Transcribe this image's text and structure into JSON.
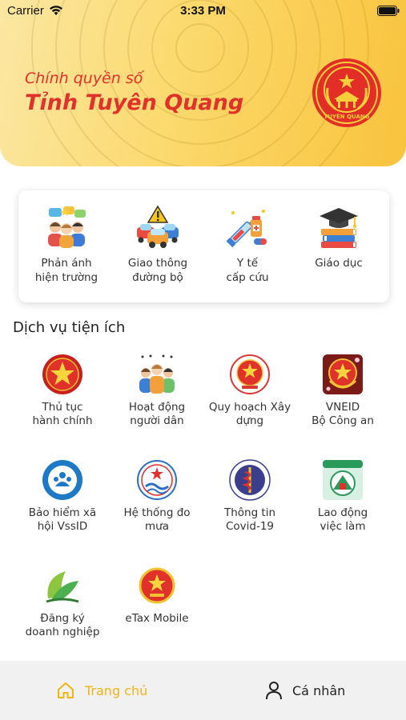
{
  "status_bar": {
    "carrier": "Carrier",
    "time": "3:33 PM"
  },
  "header": {
    "subtitle": "Chính quyền số",
    "title": "Tỉnh Tuyên Quang",
    "emblem_text": "TUYÊN QUANG",
    "colors": {
      "title": "#e0312b",
      "gradient_start": "#fbe7a3",
      "gradient_end": "#f9c33c"
    }
  },
  "quick_actions": [
    {
      "label": "Phản ánh\nhiện trường",
      "icon": "people-feedback-icon"
    },
    {
      "label": "Giao thông\nđường bộ",
      "icon": "traffic-cars-icon"
    },
    {
      "label": "Y tế\ncấp cứu",
      "icon": "medical-syringe-icon"
    },
    {
      "label": "Giáo dục",
      "icon": "graduation-books-icon"
    }
  ],
  "services": {
    "title": "Dịch vụ tiện ích",
    "items": [
      {
        "label": "Thủ tục\nhành chính",
        "icon": "red-star-icon"
      },
      {
        "label": "Hoạt động\nngười dân",
        "icon": "people-group-icon"
      },
      {
        "label": "Quy hoạch Xây\ndựng",
        "icon": "emblem-planning-icon"
      },
      {
        "label": "VNEID\nBộ Công an",
        "icon": "police-badge-icon"
      },
      {
        "label": "Bảo hiểm xã\nhội VssID",
        "icon": "social-insurance-icon"
      },
      {
        "label": "Hệ thống đo\nmưa",
        "icon": "rain-measure-icon"
      },
      {
        "label": "Thông tin\nCovid-19",
        "icon": "health-ministry-icon"
      },
      {
        "label": "Lao động\nviệc làm",
        "icon": "labor-employment-icon"
      },
      {
        "label": "Đăng ký\ndoanh nghiệp",
        "icon": "leaf-business-icon"
      },
      {
        "label": "eTax Mobile",
        "icon": "national-emblem-icon"
      }
    ]
  },
  "bottom_nav": {
    "home_label": "Trang chủ",
    "profile_label": "Cá nhân",
    "active_color": "#f3b312"
  }
}
